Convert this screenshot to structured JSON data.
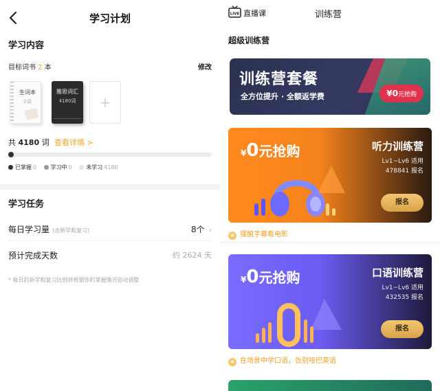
{
  "left": {
    "title": "学习计划",
    "content_section": "学习内容",
    "target_books_label": "目标词书",
    "target_books_count": "2",
    "target_books_unit": "本",
    "edit_label": "修改",
    "books": [
      {
        "title": "生词本",
        "count": "0词"
      },
      {
        "title": "雅思词汇",
        "count": "4180词"
      }
    ],
    "add_book_symbol": "+",
    "total_prefix": "共",
    "total_words": "4180",
    "total_unit": "词",
    "detail_link": "查看详情 >",
    "progress": {
      "mastered": 0,
      "learning": 0,
      "unlearned": 4180,
      "total": 4180
    },
    "legend": [
      {
        "label": "已掌握",
        "count": "0",
        "color": "#333333"
      },
      {
        "label": "学习中",
        "count": "0",
        "color": "#999999"
      },
      {
        "label": "未学习",
        "count": "4180",
        "color": "#e5e5e5"
      }
    ],
    "task_section": "学习任务",
    "daily_label": "每日学习量",
    "daily_sub": "(含新学和复习)",
    "daily_value": "8个",
    "days_label": "预计完成天数",
    "days_value": "约 2624 天",
    "note": "* 每日的新学和复习比例将根据你的掌握情况自动调整"
  },
  "right": {
    "live_badge": "LIVE",
    "live_label": "直播课",
    "title": "训练营",
    "section": "超级训练营",
    "banner": {
      "big": "训练营套餐",
      "small": "全方位提升 · 全额返学费",
      "pill_price": "¥0",
      "pill_text": "元抢购"
    },
    "cards": [
      {
        "yen": "¥",
        "zero": "0",
        "price_text": "元抢购",
        "name": "听力训练营",
        "level": "Lv1~Lv6 适用",
        "signups": "478841 报名",
        "button": "报名",
        "tag": "摆脱字幕看电影",
        "accent": "#ff8a1e"
      },
      {
        "yen": "¥",
        "zero": "0",
        "price_text": "元抢购",
        "name": "口语训练营",
        "level": "Lv1~Lv6 适用",
        "signups": "432535 报名",
        "button": "报名",
        "tag": "在场景中学口语，告别哑巴英语",
        "accent": "#7a6cff"
      }
    ]
  },
  "colors": {
    "accent_orange": "#f5a623",
    "banner_dark": "#2b3150",
    "signup_gold": "#e2b45d"
  }
}
